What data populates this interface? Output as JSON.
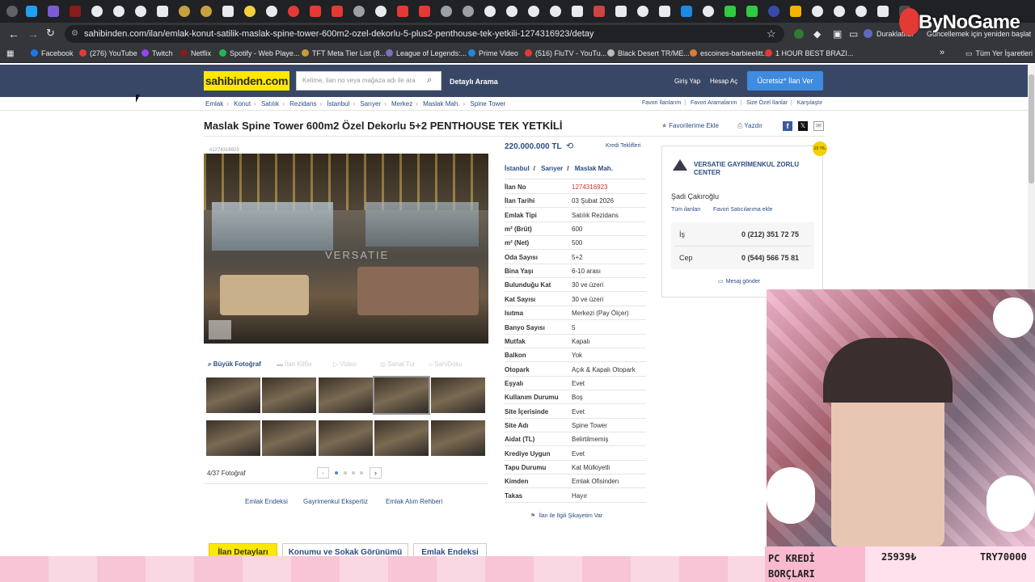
{
  "browser": {
    "url": "sahibinden.com/ilan/emlak-konut-satilik-maslak-spine-tower-600m2-ozel-dekorlu-5-plus2-penthouse-tek-yetkili-1274316923/detay",
    "paused_label": "Duraklatıldı",
    "update_label": "Güncellemek için yeniden başlat",
    "bookmarks": [
      "Facebook",
      "(276) YouTube",
      "Twitch",
      "Netflix",
      "Spotify - Web Playe...",
      "TFT Meta Tier List (8...",
      "League of Legends:...",
      "Prime Video",
      "(516) FluTV - YouTu...",
      "Black Desert TR/ME...",
      "escoines-barbieelitt...",
      "1 HOUR BEST BRAZI..."
    ],
    "all_bookmarks": "Tüm Yer İşaretleri"
  },
  "site": {
    "logo": "sahibinden.com",
    "search_placeholder": "Kelime, ilan no veya mağaza adı ile ara",
    "advanced_search": "Detaylı Arama",
    "login": "Giriş Yap",
    "signup": "Hesap Aç",
    "free_ad": "Ücretsiz* İlan Ver"
  },
  "breadcrumb": [
    "Emlak",
    "Konut",
    "Satılık",
    "Rezidans",
    "İstanbul",
    "Sarıyer",
    "Merkez",
    "Maslak Mah.",
    "Spine Tower"
  ],
  "breadcrumb_right": [
    "Favori İlanlarım",
    "Favori Aramalarım",
    "Size Özel İlanlar",
    "Karşılaştır"
  ],
  "listing": {
    "title": "Maslak Spine Tower 600m2 Özel Dekorlu 5+2 PENTHOUSE TEK YETKİLİ",
    "add_favorite": "Favorilerime Ekle",
    "print": "Yazdır",
    "listing_id_small": "#1274316923",
    "price": "220.000.000 TL",
    "credit_offers": "Kredi Teklifleri",
    "location": [
      "İstanbul",
      "Sarıyer",
      "Maslak Mah."
    ],
    "details": [
      {
        "k": "İlan No",
        "v": "1274316923"
      },
      {
        "k": "İlan Tarihi",
        "v": "03 Şubat 2026"
      },
      {
        "k": "Emlak Tipi",
        "v": "Satılık Rezidans"
      },
      {
        "k": "m² (Brüt)",
        "v": "600"
      },
      {
        "k": "m² (Net)",
        "v": "500"
      },
      {
        "k": "Oda Sayısı",
        "v": "5+2"
      },
      {
        "k": "Bina Yaşı",
        "v": "6-10 arası"
      },
      {
        "k": "Bulunduğu Kat",
        "v": "30 ve üzeri"
      },
      {
        "k": "Kat Sayısı",
        "v": "30 ve üzeri"
      },
      {
        "k": "Isıtma",
        "v": "Merkezi (Pay Ölçer)"
      },
      {
        "k": "Banyo Sayısı",
        "v": "5"
      },
      {
        "k": "Mutfak",
        "v": "Kapalı"
      },
      {
        "k": "Balkon",
        "v": "Yok"
      },
      {
        "k": "Otopark",
        "v": "Açık & Kapalı Otopark"
      },
      {
        "k": "Eşyalı",
        "v": "Evet"
      },
      {
        "k": "Kullanım Durumu",
        "v": "Boş"
      },
      {
        "k": "Site İçerisinde",
        "v": "Evet"
      },
      {
        "k": "Site Adı",
        "v": "Spine Tower"
      },
      {
        "k": "Aidat (TL)",
        "v": "Belirtilmemiş"
      },
      {
        "k": "Krediye Uygun",
        "v": "Evet"
      },
      {
        "k": "Tapu Durumu",
        "v": "Kat Mülkiyetli"
      },
      {
        "k": "Kimden",
        "v": "Emlak Ofisinden"
      },
      {
        "k": "Takas",
        "v": "Hayır"
      }
    ],
    "report": "İlan ile İlgili Şikayetim Var",
    "gallery_tabs": [
      "Büyük Fotoğraf",
      "İlan Kliби",
      "Video",
      "Sanal Tur",
      "SahiDoku"
    ],
    "photo_counter": "4/37 Fotoğraf",
    "watermark": "VERSATIE",
    "links": [
      "Emlak Endeksi",
      "Gayrimenkul Ekspertiz",
      "Emlak Alım Rehberi"
    ],
    "bottom_tabs": [
      "İlan Detayları",
      "Konumu ve Sokak Görünümü",
      "Emlak Endeksi"
    ]
  },
  "seller": {
    "office": "VERSATIE GAYRİMENKUL ZORLU CENTER",
    "agent": "Şadi Çakıroğlu",
    "all_ads": "Tüm ilanları",
    "fav_seller": "Favori Satıcılarıma ekle",
    "phones": [
      {
        "label": "İş",
        "number": "0 (212) 351 72 75"
      },
      {
        "label": "Cep",
        "number": "0 (544) 566 75 81"
      }
    ],
    "message": "Mesaj gönder",
    "badge": "15 YIL"
  },
  "overlay": {
    "brand": "ByNoGame",
    "kredi_label": "PC KREDİ BORÇLARI",
    "amount1": "25939₺",
    "amount2": "TRY70000"
  }
}
